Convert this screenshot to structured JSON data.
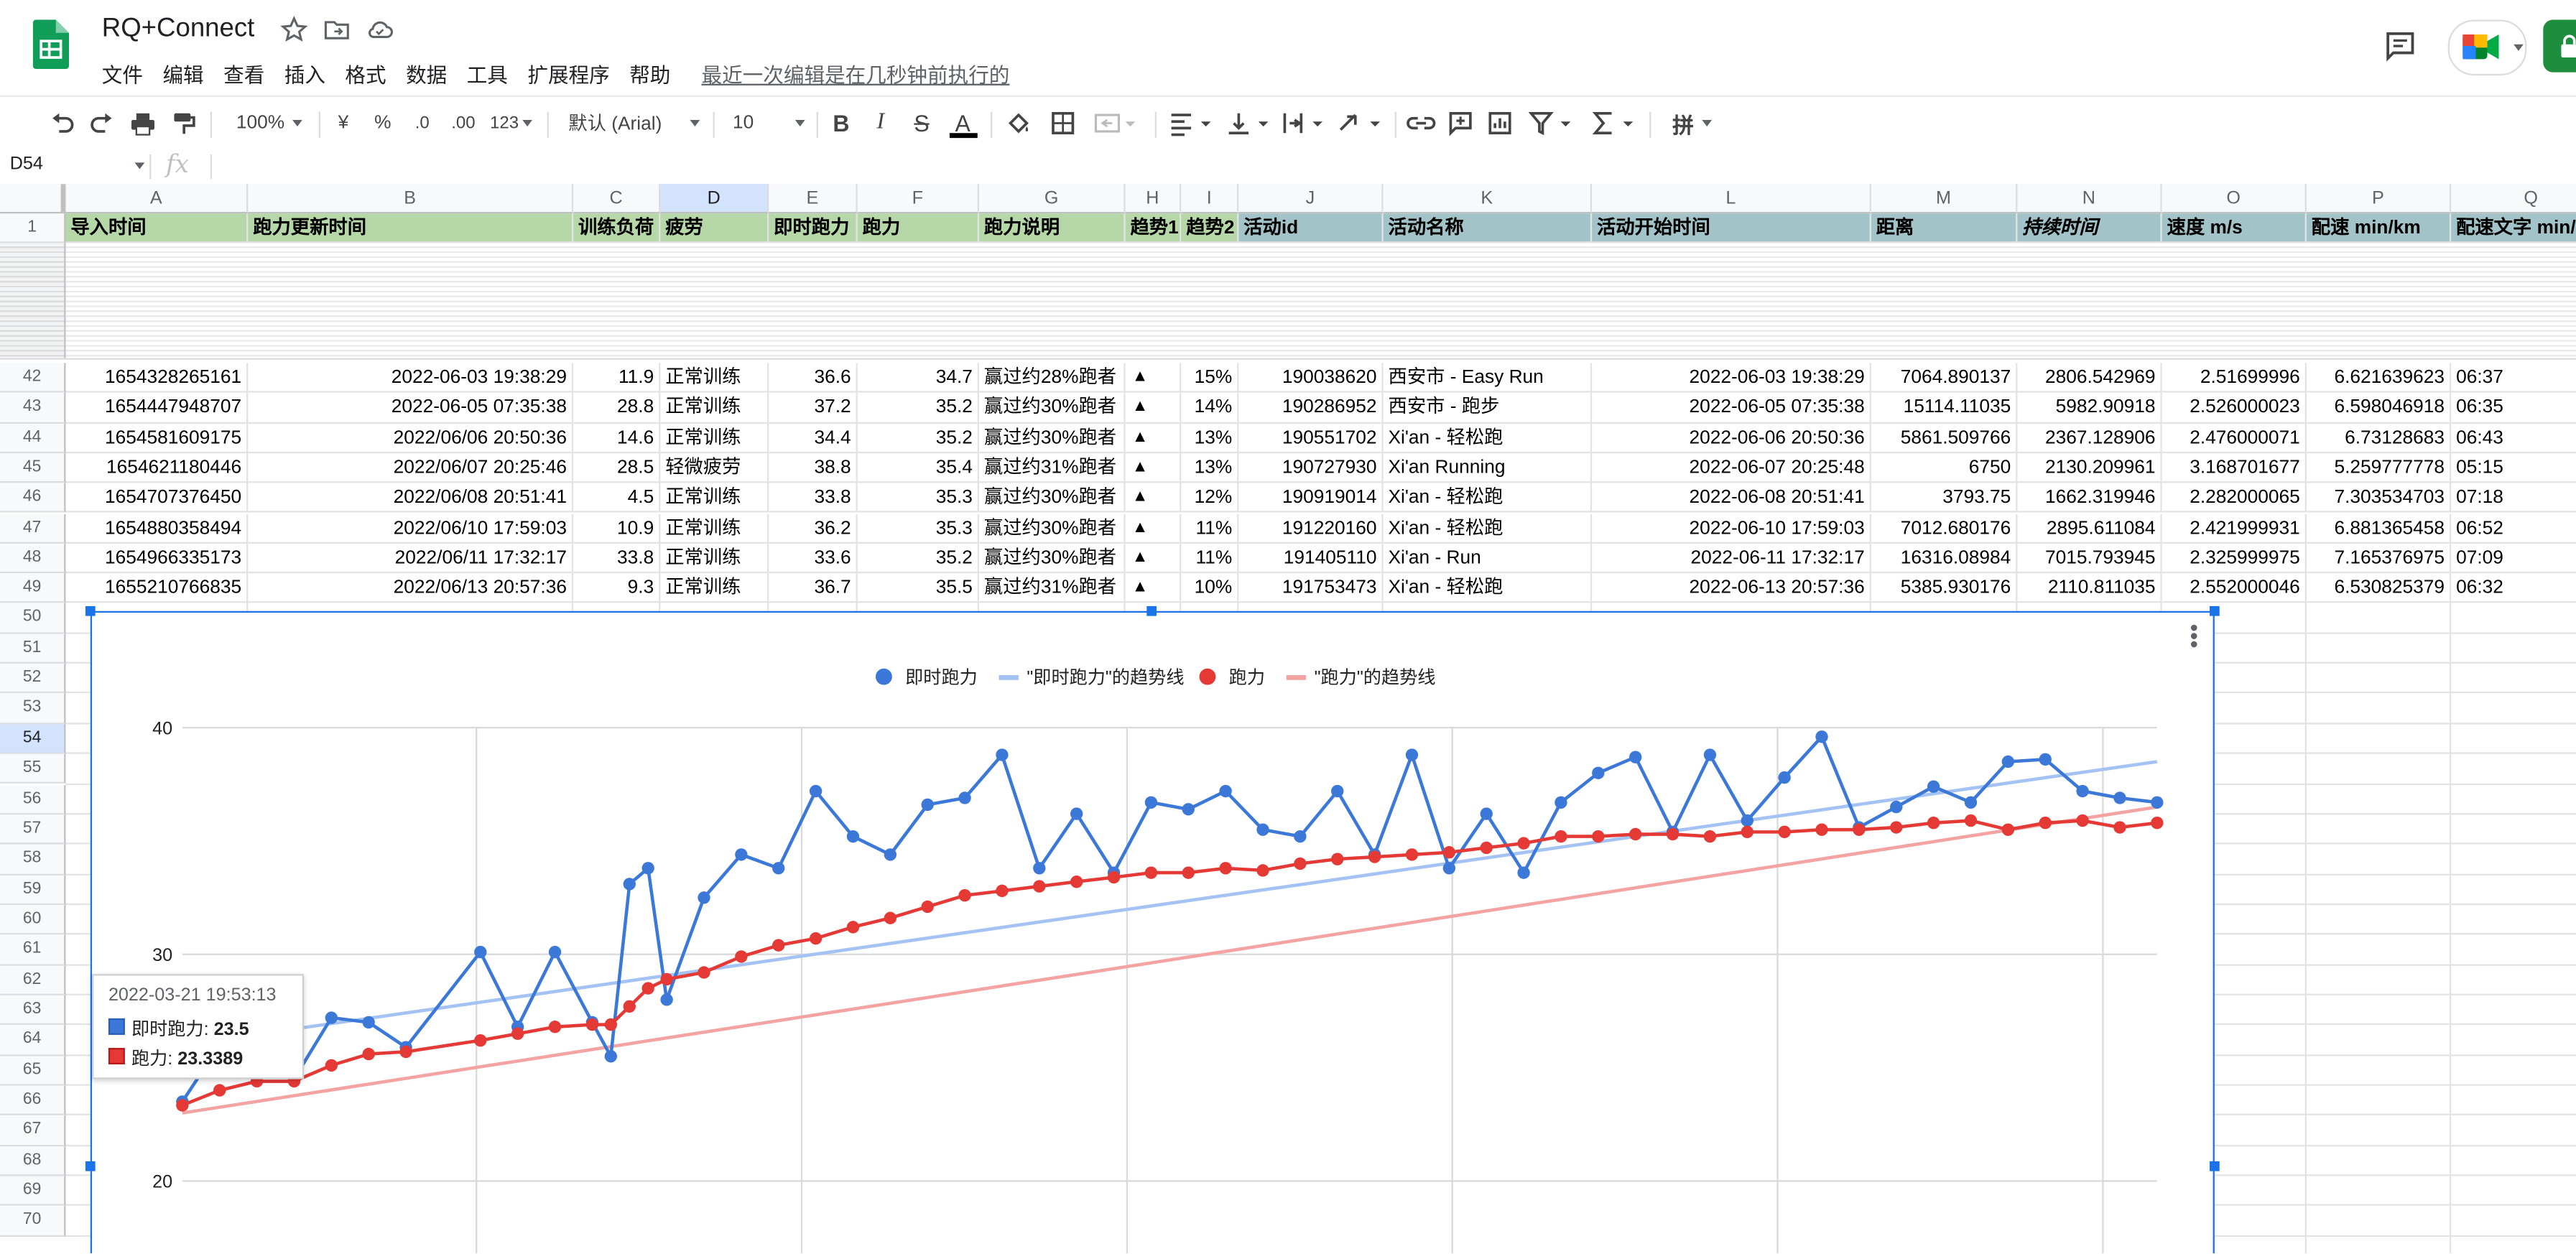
{
  "app": {
    "doc_title": "RQ+Connect",
    "menu": [
      "文件",
      "编辑",
      "查看",
      "插入",
      "格式",
      "数据",
      "工具",
      "扩展程序",
      "帮助"
    ],
    "last_edit": "最近一次编辑是在几秒钟前执行的",
    "accent": "#0f9d58"
  },
  "toolbar": {
    "zoom": "100%",
    "currency": "¥",
    "percent": "%",
    "dec_less": ".0",
    "dec_more": ".00",
    "format_more": "123",
    "font": "默认 (Arial)",
    "font_size": "10",
    "bold": "B",
    "italic": "I",
    "strike": "S",
    "text_color": "A",
    "input_tools": "拼"
  },
  "formula_bar": {
    "name_box": "D54",
    "fx": "fx",
    "content": ""
  },
  "columns": [
    {
      "letter": "A",
      "header": "导入时间",
      "group": "g"
    },
    {
      "letter": "B",
      "header": "跑力更新时间",
      "group": "g"
    },
    {
      "letter": "C",
      "header": "训练负荷",
      "group": "g"
    },
    {
      "letter": "D",
      "header": "疲劳",
      "group": "g"
    },
    {
      "letter": "E",
      "header": "即时跑力",
      "group": "g"
    },
    {
      "letter": "F",
      "header": "跑力",
      "group": "g"
    },
    {
      "letter": "G",
      "header": "跑力说明",
      "group": "g"
    },
    {
      "letter": "H",
      "header": "趋势1",
      "group": "g"
    },
    {
      "letter": "I",
      "header": "趋势2",
      "group": "g"
    },
    {
      "letter": "J",
      "header": "活动id",
      "group": "b"
    },
    {
      "letter": "K",
      "header": "活动名称",
      "group": "b"
    },
    {
      "letter": "L",
      "header": "活动开始时间",
      "group": "b"
    },
    {
      "letter": "M",
      "header": "距离",
      "group": "b"
    },
    {
      "letter": "N",
      "header": "持续时间",
      "group": "b"
    },
    {
      "letter": "O",
      "header": "速度 m/s",
      "group": "b"
    },
    {
      "letter": "P",
      "header": "配速 min/km",
      "group": "b"
    },
    {
      "letter": "Q",
      "header": "配速文字 min/km",
      "group": "b"
    }
  ],
  "header_row_number": "1",
  "rows": [
    {
      "num": "42",
      "cells": [
        "1654328265161",
        "2022-06-03 19:38:29",
        "11.9",
        "正常训练",
        "36.6",
        "34.7",
        "赢过约28%跑者",
        "▲",
        "15%",
        "190038620",
        "西安市 - Easy Run",
        "2022-06-03 19:38:29",
        "7064.890137",
        "2806.542969",
        "2.51699996",
        "6.621639623",
        "06:37"
      ]
    },
    {
      "num": "43",
      "cells": [
        "1654447948707",
        "2022-06-05 07:35:38",
        "28.8",
        "正常训练",
        "37.2",
        "35.2",
        "赢过约30%跑者",
        "▲",
        "14%",
        "190286952",
        "西安市 - 跑步",
        "2022-06-05 07:35:38",
        "15114.11035",
        "5982.90918",
        "2.526000023",
        "6.598046918",
        "06:35"
      ]
    },
    {
      "num": "44",
      "cells": [
        "1654581609175",
        "2022/06/06 20:50:36",
        "14.6",
        "正常训练",
        "34.4",
        "35.2",
        "赢过约30%跑者",
        "▲",
        "13%",
        "190551702",
        "Xi'an - 轻松跑",
        "2022-06-06 20:50:36",
        "5861.509766",
        "2367.128906",
        "2.476000071",
        "6.73128683",
        "06:43"
      ]
    },
    {
      "num": "45",
      "cells": [
        "1654621180446",
        "2022/06/07 20:25:46",
        "28.5",
        "轻微疲劳",
        "38.8",
        "35.4",
        "赢过约31%跑者",
        "▲",
        "13%",
        "190727930",
        "Xi'an Running",
        "2022-06-07 20:25:48",
        "6750",
        "2130.209961",
        "3.168701677",
        "5.259777778",
        "05:15"
      ]
    },
    {
      "num": "46",
      "cells": [
        "1654707376450",
        "2022/06/08 20:51:41",
        "4.5",
        "正常训练",
        "33.8",
        "35.3",
        "赢过约30%跑者",
        "▲",
        "12%",
        "190919014",
        "Xi'an - 轻松跑",
        "2022-06-08 20:51:41",
        "3793.75",
        "1662.319946",
        "2.282000065",
        "7.303534703",
        "07:18"
      ]
    },
    {
      "num": "47",
      "cells": [
        "1654880358494",
        "2022/06/10 17:59:03",
        "10.9",
        "正常训练",
        "36.2",
        "35.3",
        "赢过约30%跑者",
        "▲",
        "11%",
        "191220160",
        "Xi'an - 轻松跑",
        "2022-06-10 17:59:03",
        "7012.680176",
        "2895.611084",
        "2.421999931",
        "6.881365458",
        "06:52"
      ]
    },
    {
      "num": "48",
      "cells": [
        "1654966335173",
        "2022/06/11 17:32:17",
        "33.8",
        "正常训练",
        "33.6",
        "35.2",
        "赢过约30%跑者",
        "▲",
        "11%",
        "191405110",
        "Xi'an - Run",
        "2022-06-11 17:32:17",
        "16316.08984",
        "7015.793945",
        "2.325999975",
        "7.165376975",
        "07:09"
      ]
    },
    {
      "num": "49",
      "cells": [
        "1655210766835",
        "2022/06/13 20:57:36",
        "9.3",
        "正常训练",
        "36.7",
        "35.5",
        "赢过约31%跑者",
        "▲",
        "10%",
        "191753473",
        "Xi'an - 轻松跑",
        "2022-06-13 20:57:36",
        "5385.930176",
        "2110.811035",
        "2.552000046",
        "6.530825379",
        "06:32"
      ]
    }
  ],
  "empty_rows": [
    "50",
    "51",
    "52",
    "53",
    "54",
    "55",
    "56",
    "57",
    "58",
    "59",
    "60",
    "61",
    "62",
    "63",
    "64",
    "65",
    "66",
    "67",
    "68",
    "69",
    "70"
  ],
  "selected_cell": "D54",
  "chart_data": {
    "type": "scatter",
    "legend": [
      "即时跑力",
      "\"即时跑力\"的趋势线",
      "跑力",
      "\"跑力\"的趋势线"
    ],
    "legend_position": "top",
    "ylim": [
      16,
      43
    ],
    "yticks": [
      20,
      30,
      40
    ],
    "grid": true,
    "series": [
      {
        "name": "即时跑力",
        "color": "#3c78d8",
        "connect": true,
        "x": [
          0,
          1,
          2,
          3,
          4,
          5,
          6,
          8,
          9,
          10,
          11,
          11.5,
          12,
          12.5,
          13,
          14,
          15,
          16,
          17,
          18,
          19,
          20,
          21,
          22,
          23,
          24,
          25,
          26,
          27,
          28,
          29,
          30,
          31,
          32,
          33,
          34,
          35,
          36,
          37,
          38,
          39,
          40,
          41,
          42,
          43,
          44,
          45,
          46,
          47,
          48,
          49,
          50,
          51,
          52,
          53
        ],
        "y": [
          23.5,
          26,
          25.7,
          24.5,
          27.2,
          27,
          25.9,
          30.1,
          26.8,
          30.1,
          27,
          25.5,
          33.1,
          33.8,
          28,
          32.5,
          34.4,
          33.8,
          37.2,
          35.2,
          34.4,
          36.6,
          36.9,
          38.8,
          33.8,
          36.2,
          33.6,
          36.7,
          36.4,
          37.2,
          35.5,
          35.2,
          37.2,
          34.4,
          38.8,
          33.8,
          36.2,
          33.6,
          36.7,
          38,
          38.7,
          35.4,
          38.8,
          35.9,
          37.8,
          39.6,
          35.6,
          36.5,
          37.4,
          36.7,
          38.5,
          38.6,
          37.2,
          36.9,
          36.7
        ]
      },
      {
        "name": "\"即时跑力\"的趋势线",
        "color": "#a4c2f4",
        "trend": true,
        "x": [
          0,
          53
        ],
        "y": [
          26.0,
          38.5
        ]
      },
      {
        "name": "跑力",
        "color": "#e53935",
        "connect": true,
        "x": [
          0,
          1,
          2,
          3,
          4,
          5,
          6,
          8,
          9,
          10,
          11,
          11.5,
          12,
          12.5,
          13,
          14,
          15,
          16,
          17,
          18,
          19,
          20,
          21,
          22,
          23,
          24,
          25,
          26,
          27,
          28,
          29,
          30,
          31,
          32,
          33,
          34,
          35,
          36,
          37,
          38,
          39,
          40,
          41,
          42,
          43,
          44,
          45,
          46,
          47,
          48,
          49,
          50,
          51,
          52,
          53
        ],
        "y": [
          23.3389,
          24.0,
          24.4,
          24.4,
          25.1,
          25.6,
          25.7,
          26.2,
          26.5,
          26.8,
          26.9,
          26.9,
          27.7,
          28.5,
          28.9,
          29.2,
          29.9,
          30.4,
          30.7,
          31.2,
          31.6,
          32.1,
          32.6,
          32.8,
          33.0,
          33.2,
          33.4,
          33.6,
          33.6,
          33.8,
          33.7,
          34.0,
          34.2,
          34.3,
          34.4,
          34.5,
          34.7,
          34.9,
          35.2,
          35.2,
          35.3,
          35.3,
          35.2,
          35.4,
          35.4,
          35.5,
          35.5,
          35.6,
          35.8,
          35.9,
          35.5,
          35.8,
          35.9,
          35.6,
          35.8
        ]
      },
      {
        "name": "\"跑力\"的趋势线",
        "color": "#f4a3a3",
        "trend": true,
        "x": [
          0,
          53
        ],
        "y": [
          23.0,
          36.5
        ]
      }
    ],
    "tooltip": {
      "date": "2022-03-21 19:53:13",
      "label1": "即时跑力: ",
      "value1": "23.5",
      "label2": "跑力: ",
      "value2": "23.3389"
    }
  }
}
